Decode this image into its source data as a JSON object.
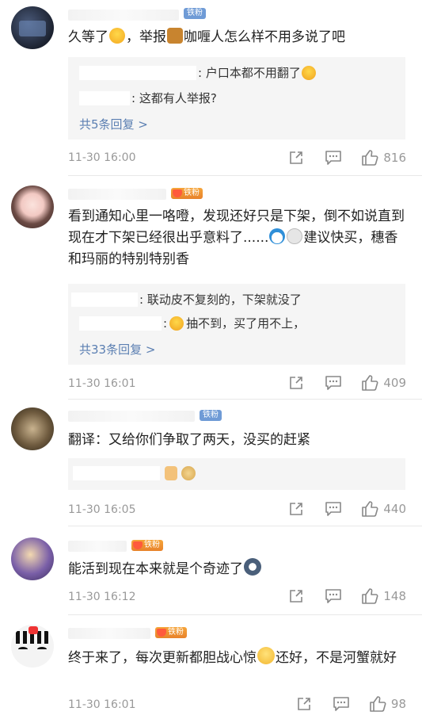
{
  "comments": [
    {
      "badge": "铁粉",
      "text_before": "久等了",
      "text_mid": "，举报",
      "text_after": "咖喱人怎么样不用多说了吧",
      "replies": [
        {
          "text": ": 户口本都不用翻了"
        },
        {
          "text": ": 这都有人举报?"
        }
      ],
      "more": "共5条回复 >",
      "time": "11-30 16:00",
      "likes": "816"
    },
    {
      "badge": "铁粉",
      "text_a": "看到通知心里一咯噔，发现还好只是下架，倒不如说直到现在才下架已经很出乎意料了......",
      "text_b": "建议快买，穗香和玛丽的特别特别香",
      "replies": [
        {
          "text": ": 联动皮不复刻的，下架就没了"
        },
        {
          "text": "抽不到，买了用不上，"
        }
      ],
      "more": "共33条回复 >",
      "time": "11-30 16:01",
      "likes": "409"
    },
    {
      "badge": "铁粉",
      "text": "翻译：又给你们争取了两天，没买的赶紧",
      "time": "11-30 16:05",
      "likes": "440"
    },
    {
      "badge": "铁粉",
      "text": "能活到现在本来就是个奇迹了",
      "time": "11-30 16:12",
      "likes": "148"
    },
    {
      "badge": "铁粉",
      "text_a": "终于来了，每次更新都胆战心惊",
      "text_b": "还好，不是河蟹就好",
      "time": "11-30 16:01",
      "likes": "98"
    }
  ],
  "icons": {
    "share": "share-icon",
    "comment": "comment-icon",
    "like": "thumbs-up-icon"
  },
  "colors": {
    "link": "#5b7fb2",
    "meta": "#999999",
    "reply_bg": "#f5f5f5",
    "badge_blue": "#6f9bd6",
    "badge_gold": "#f0962f"
  }
}
